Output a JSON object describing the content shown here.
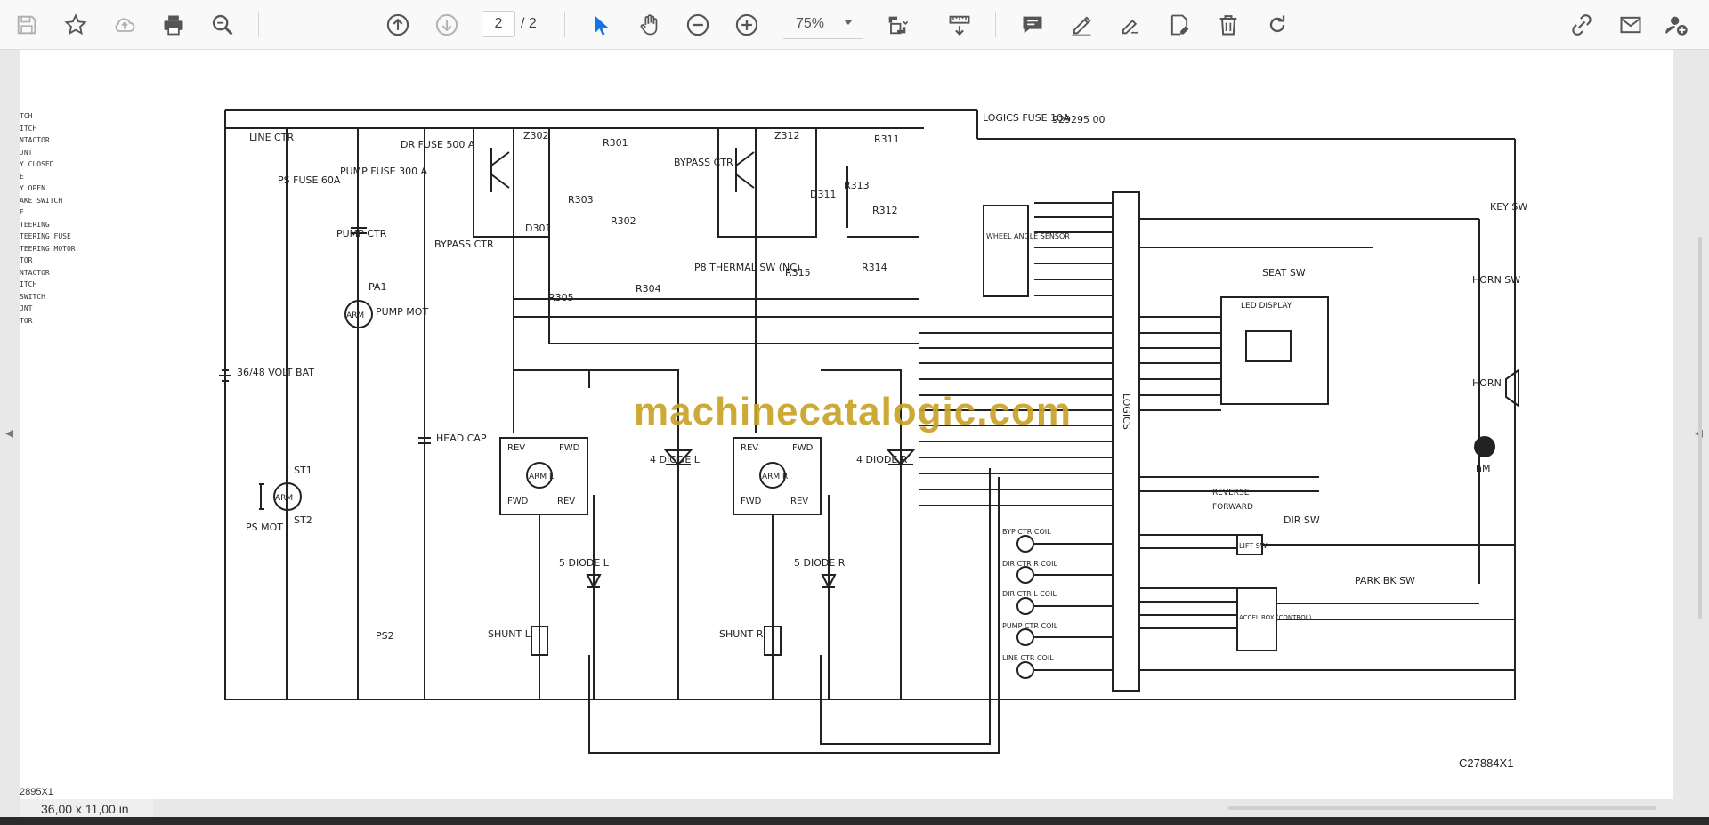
{
  "toolbar": {
    "buttons": [
      {
        "name": "save",
        "icon": "save-icon"
      },
      {
        "name": "bookmark",
        "icon": "star-icon"
      },
      {
        "name": "upload",
        "icon": "cloud-upload-icon"
      },
      {
        "name": "print",
        "icon": "printer-icon"
      },
      {
        "name": "find",
        "icon": "magnifier-icon"
      },
      {
        "name": "prev-page",
        "icon": "arrow-up-circle-icon"
      },
      {
        "name": "next-page",
        "icon": "arrow-down-circle-icon"
      },
      {
        "name": "select",
        "icon": "cursor-icon"
      },
      {
        "name": "pan",
        "icon": "hand-icon"
      },
      {
        "name": "zoom-out",
        "icon": "minus-circle-icon"
      },
      {
        "name": "zoom-in",
        "icon": "plus-circle-icon"
      },
      {
        "name": "fit",
        "icon": "fit-page-icon"
      },
      {
        "name": "measure",
        "icon": "ruler-icon"
      },
      {
        "name": "comment",
        "icon": "comment-icon"
      },
      {
        "name": "highlight",
        "icon": "pen-icon"
      },
      {
        "name": "sign",
        "icon": "signature-icon"
      },
      {
        "name": "stamp",
        "icon": "stamp-icon"
      },
      {
        "name": "delete",
        "icon": "trash-icon"
      },
      {
        "name": "rotate",
        "icon": "rotate-icon"
      },
      {
        "name": "share",
        "icon": "share-link-icon"
      },
      {
        "name": "email",
        "icon": "mail-icon"
      },
      {
        "name": "account",
        "icon": "user-add-icon"
      }
    ],
    "page_current": "2",
    "page_total": "/ 2",
    "zoom": "75%"
  },
  "document": {
    "legend_fragments": [
      "TCH",
      "ITCH",
      "NTACTOR",
      "JNT",
      "Y CLOSED",
      "E",
      "Y OPEN",
      "AKE SWITCH",
      "E",
      "TEERING",
      "TEERING FUSE",
      "TEERING MOTOR",
      "TOR",
      "NTACTOR",
      "ITCH",
      "SWITCH",
      "JNT",
      "TOR"
    ],
    "drawing_ref": "929295 00",
    "drawing_number": "C27884X1",
    "bottom_fragment": "2895X1",
    "watermark": "machinecatalogic.com",
    "labels": {
      "line_ctr": "LINE CTR",
      "ps_fuse": "PS FUSE 60A",
      "pump_fuse": "PUMP FUSE 300 A",
      "dr_fuse": "DR FUSE 500 A",
      "pump_ctr": "PUMP CTR",
      "pump_mot": "PUMP MOT",
      "pa1": "PA1",
      "battery": "36/48 VOLT BAT",
      "ps_mot": "PS MOT",
      "st1": "ST1",
      "st2": "ST2",
      "ps2": "PS2",
      "head_cap": "HEAD CAP",
      "bypass_ctr_l": "BYPASS CTR",
      "bypass_ctr_r": "BYPASS CTR",
      "z302": "Z302",
      "z312": "Z312",
      "r301": "R301",
      "r302": "R302",
      "r303": "R303",
      "r304": "R304",
      "r305": "R305",
      "r311": "R311",
      "r312": "R312",
      "r313": "R313",
      "r314": "R314",
      "r315": "R315",
      "d301": "D301",
      "d311": "D311",
      "p8_thermal": "P8 THERMAL SW (NC)",
      "logics_fuse": "LOGICS FUSE 10A",
      "logics": "LOGICS",
      "wheel_angle": "WHEEL ANGLE SENSOR",
      "key_sw": "KEY SW",
      "horn_sw": "HORN SW",
      "horn": "HORN",
      "seat_sw": "SEAT SW",
      "led_display": "LED DISPLAY",
      "dir_sw": "DIR SW",
      "reverse": "REVERSE",
      "forward": "FORWARD",
      "lift_sw": "LIFT SW",
      "park_bk": "PARK BK SW",
      "accel_box": "ACCEL BOX (CONTROL)",
      "hm": "hM",
      "diode_l4": "4 DIODE L",
      "diode_r4": "4 DIODE R",
      "diode_l5": "5 DIODE L",
      "diode_r5": "5 DIODE R",
      "shunt_l": "SHUNT L",
      "shunt_r": "SHUNT R",
      "rev": "REV",
      "fwd": "FWD",
      "arm": "ARM",
      "arm_l": "ARM L",
      "arm_r": "ARM R",
      "byp_ctr_coil": "BYP CTR COIL",
      "dir_ctr_r_coil": "DIR CTR R COIL",
      "dir_ctr_l_coil": "DIR CTR L COIL",
      "pump_ctr_coil": "PUMP CTR COIL",
      "line_ctr_coil": "LINE CTR COIL"
    }
  },
  "status": {
    "page_size": "36,00 x 11,00 in"
  }
}
